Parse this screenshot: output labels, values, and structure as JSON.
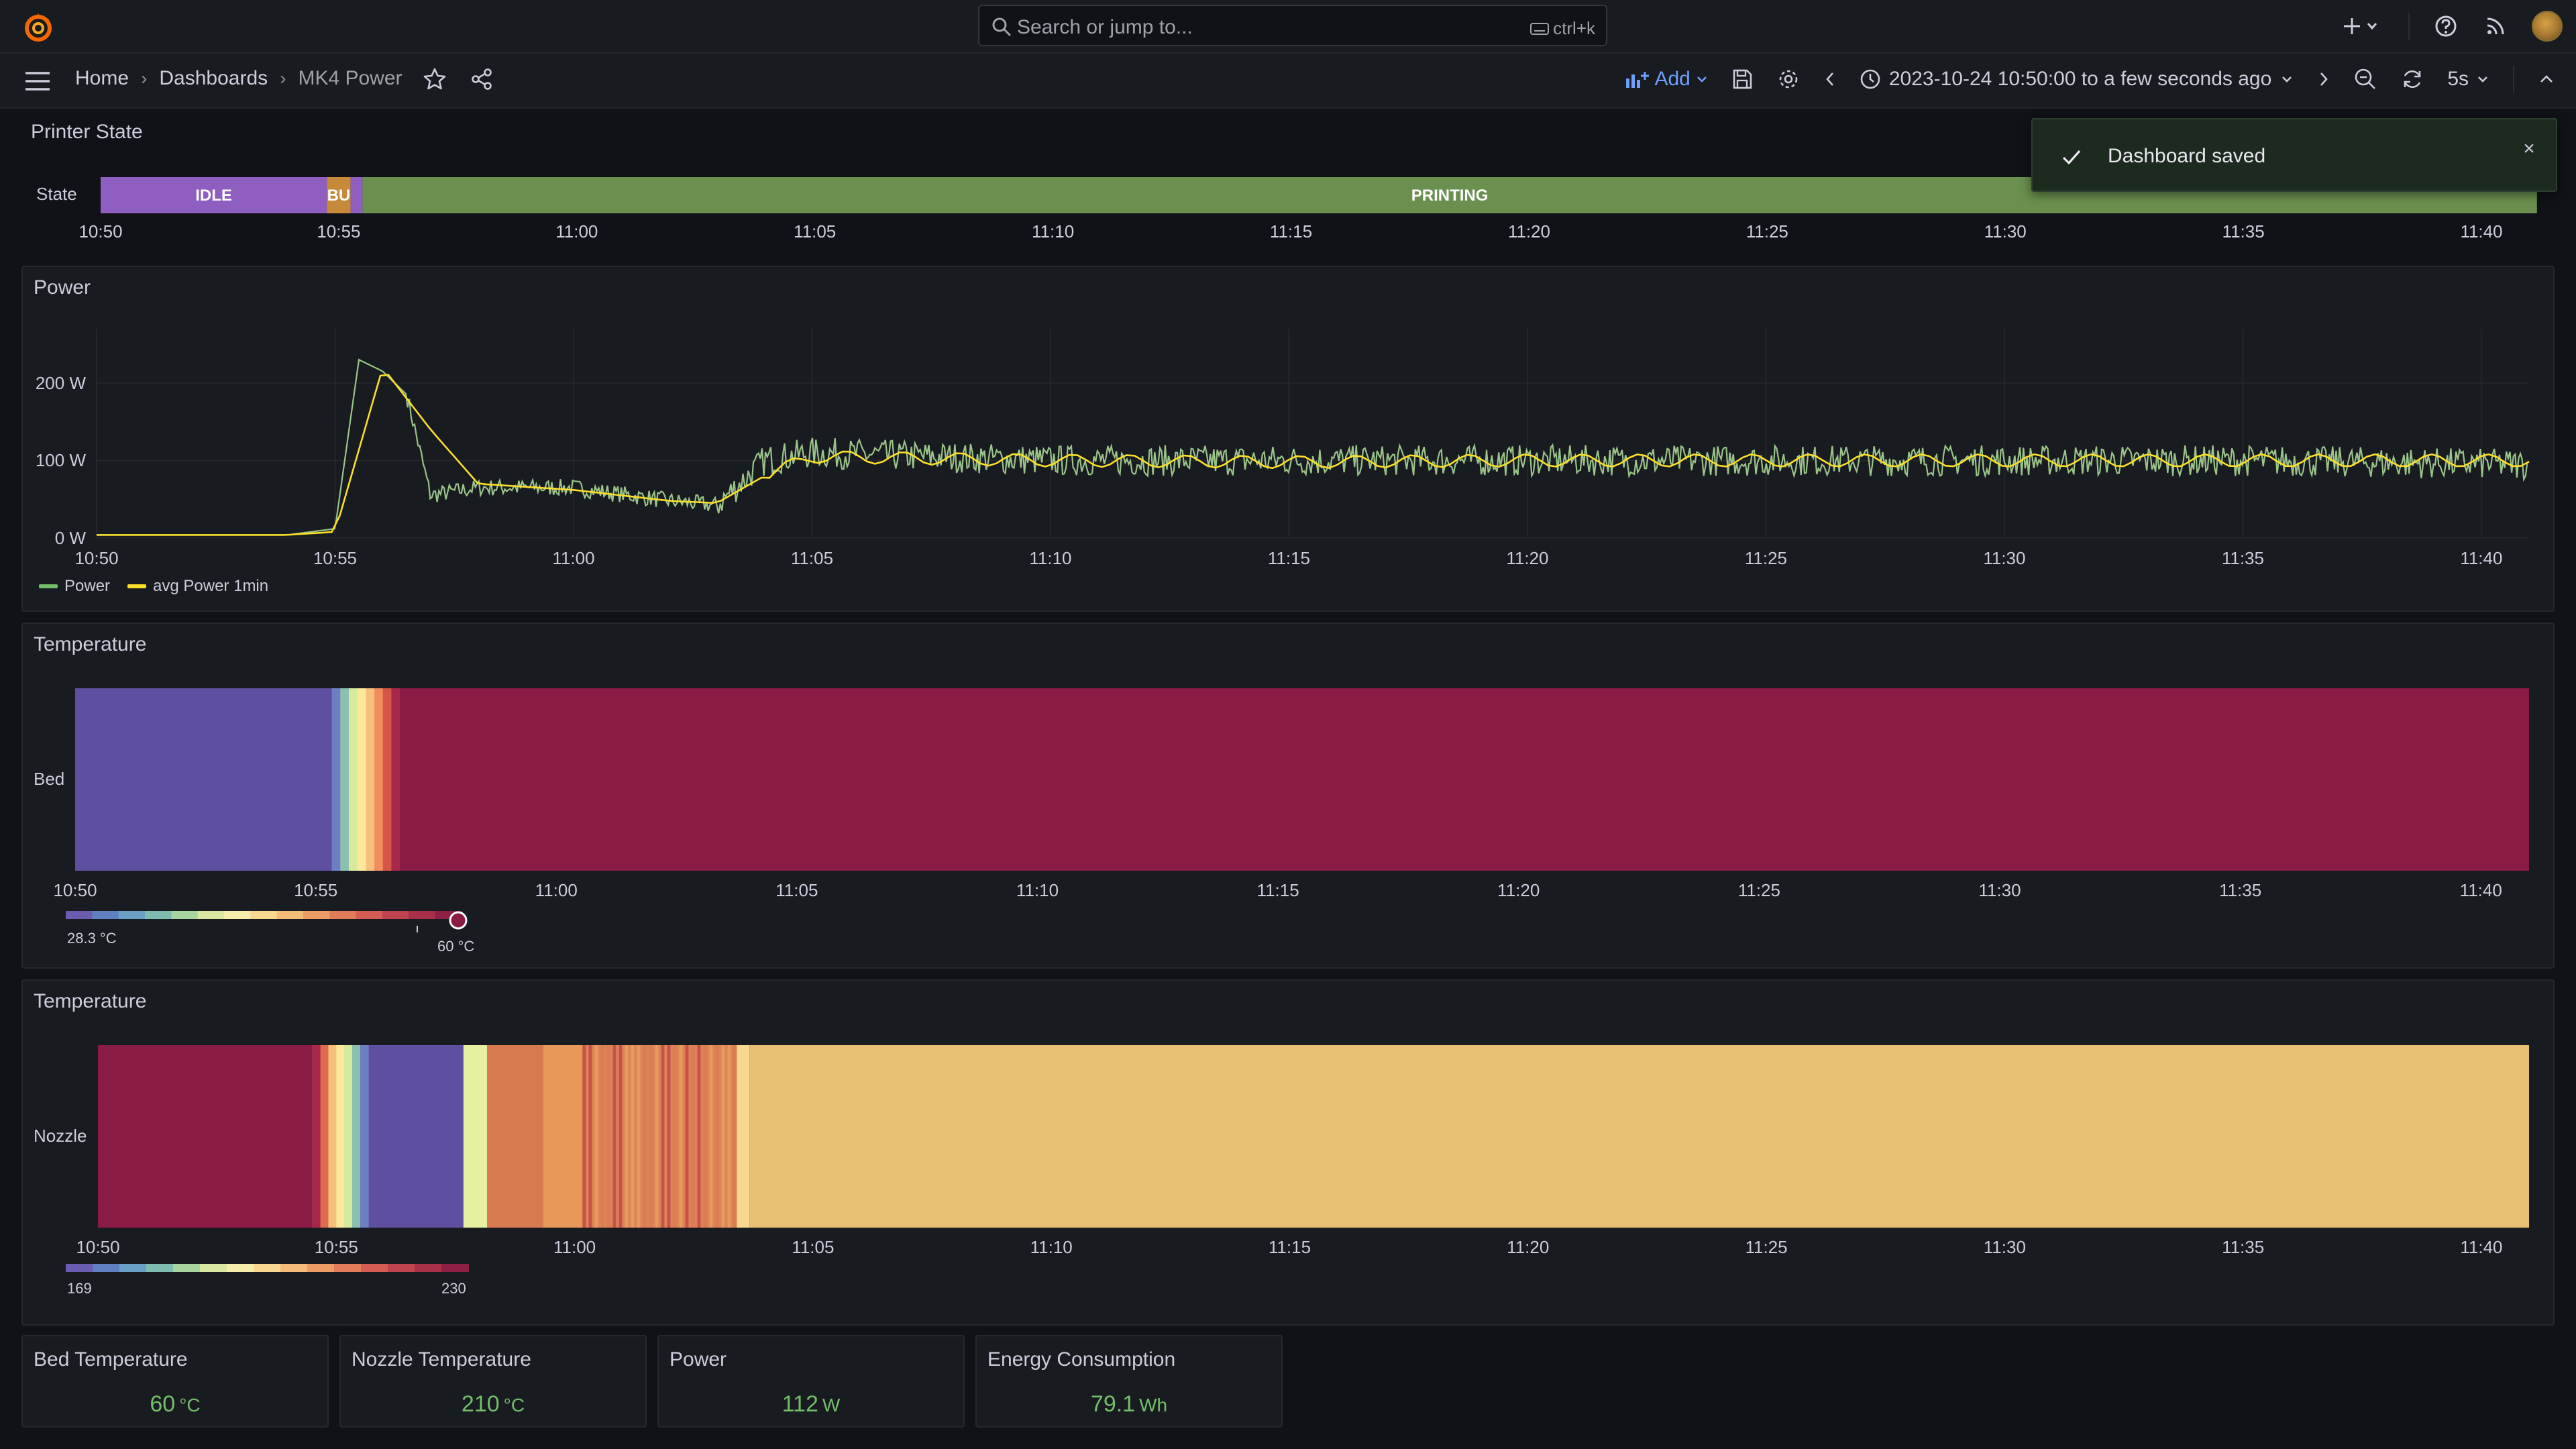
{
  "topbar": {
    "search_placeholder": "Search or jump to...",
    "search_shortcut": "ctrl+k"
  },
  "breadcrumb": {
    "home": "Home",
    "dashboards": "Dashboards",
    "current": "MK4 Power"
  },
  "toolbar": {
    "add_label": "Add",
    "time_range": "2023-10-24 10:50:00 to a few seconds ago",
    "refresh_interval": "5s"
  },
  "toast": {
    "message": "Dashboard saved"
  },
  "state_panel": {
    "title": "Printer State",
    "row_label": "State",
    "segments": [
      {
        "label": "IDLE",
        "start": "10:50:00",
        "end": "10:54:45",
        "color": "#8e5ec0"
      },
      {
        "label": "BU",
        "start": "10:54:45",
        "end": "10:55:15",
        "color": "#c7893a"
      },
      {
        "label": "",
        "start": "10:55:15",
        "end": "10:55:30",
        "color": "#8e5ec0"
      },
      {
        "label": "PRINTING",
        "start": "10:55:30",
        "end": "11:41:10",
        "color": "#6b8f4e"
      }
    ],
    "x_ticks": [
      "10:50",
      "10:55",
      "11:00",
      "11:05",
      "11:10",
      "11:15",
      "11:20",
      "11:25",
      "11:30",
      "11:35",
      "11:40"
    ]
  },
  "power_panel": {
    "title": "Power",
    "y_ticks": [
      "200 W",
      "100 W",
      "0 W"
    ],
    "x_ticks": [
      "10:50",
      "10:55",
      "11:00",
      "11:05",
      "11:10",
      "11:15",
      "11:20",
      "11:25",
      "11:30",
      "11:35",
      "11:40"
    ],
    "legend": [
      {
        "name": "Power",
        "color": "#73bf69"
      },
      {
        "name": "avg Power 1min",
        "color": "#fade2a"
      }
    ]
  },
  "bed_panel": {
    "title": "Temperature",
    "row_label": "Bed",
    "x_ticks": [
      "10:50",
      "10:55",
      "11:00",
      "11:05",
      "11:10",
      "11:15",
      "11:20",
      "11:25",
      "11:30",
      "11:35",
      "11:40"
    ],
    "scale_min": "28.3 °C",
    "scale_max": "60 °C"
  },
  "nozzle_panel": {
    "title": "Temperature",
    "row_label": "Nozzle",
    "x_ticks": [
      "10:50",
      "10:55",
      "11:00",
      "11:05",
      "11:10",
      "11:15",
      "11:20",
      "11:25",
      "11:30",
      "11:35",
      "11:40"
    ],
    "scale_min": "169",
    "scale_max": "230"
  },
  "stats": [
    {
      "title": "Bed Temperature",
      "value": "60",
      "unit": "°C"
    },
    {
      "title": "Nozzle Temperature",
      "value": "210",
      "unit": "°C"
    },
    {
      "title": "Power",
      "value": "112",
      "unit": "W"
    },
    {
      "title": "Energy Consumption",
      "value": "79.1",
      "unit": "Wh"
    }
  ],
  "chart_data": [
    {
      "type": "line",
      "title": "Power",
      "ylim": [
        0,
        270
      ],
      "x_range": [
        "10:50",
        "11:41"
      ],
      "series": [
        {
          "name": "Power",
          "x": [
            "10:50",
            "10:54",
            "10:55",
            "10:55:30",
            "10:56",
            "10:56:30",
            "10:57",
            "10:58",
            "11:00",
            "11:02",
            "11:03",
            "11:04",
            "11:05",
            "11:10",
            "11:15",
            "11:20",
            "11:25",
            "11:30",
            "11:35",
            "11:41"
          ],
          "values": [
            4,
            4,
            12,
            230,
            215,
            185,
            55,
            65,
            65,
            48,
            42,
            100,
            110,
            100,
            100,
            100,
            100,
            100,
            100,
            95
          ]
        },
        {
          "name": "avg Power 1min",
          "x": [
            "10:50",
            "10:54",
            "10:55",
            "10:56",
            "10:57",
            "10:58",
            "11:00",
            "11:02",
            "11:03",
            "11:04",
            "11:05",
            "11:10",
            "11:15",
            "11:20",
            "11:25",
            "11:30",
            "11:35",
            "11:41"
          ],
          "values": [
            4,
            4,
            8,
            220,
            140,
            70,
            62,
            48,
            45,
            80,
            105,
            100,
            98,
            100,
            100,
            100,
            100,
            100
          ]
        }
      ]
    }
  ]
}
